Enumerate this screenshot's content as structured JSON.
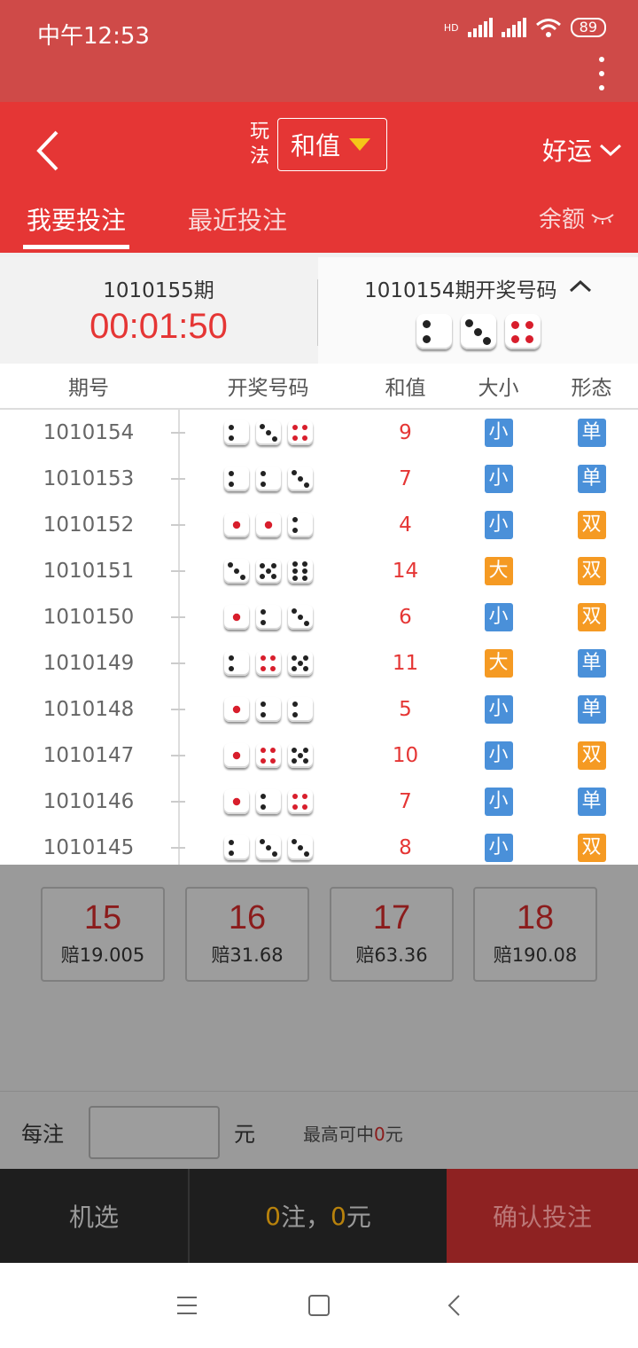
{
  "status": {
    "time": "中午12:53",
    "hd": "HD",
    "battery": "89"
  },
  "header": {
    "play_label": "玩法",
    "play_value": "和值",
    "luck_label": "好运",
    "tabs": {
      "bet": "我要投注",
      "recent": "最近投注"
    },
    "balance_label": "余额"
  },
  "period": {
    "current": "1010155期",
    "countdown": "00:01:50",
    "last_title": "1010154期开奖号码",
    "last_dice": [
      2,
      3,
      4
    ]
  },
  "table": {
    "headers": {
      "issue": "期号",
      "draw": "开奖号码",
      "sum": "和值",
      "size": "大小",
      "form": "形态"
    },
    "rows": [
      {
        "issue": "1010154",
        "dice": [
          2,
          3,
          4
        ],
        "sum": "9",
        "size": "小",
        "form": "单"
      },
      {
        "issue": "1010153",
        "dice": [
          2,
          2,
          3
        ],
        "sum": "7",
        "size": "小",
        "form": "单"
      },
      {
        "issue": "1010152",
        "dice": [
          1,
          1,
          2
        ],
        "sum": "4",
        "size": "小",
        "form": "双"
      },
      {
        "issue": "1010151",
        "dice": [
          3,
          5,
          6
        ],
        "sum": "14",
        "size": "大",
        "form": "双"
      },
      {
        "issue": "1010150",
        "dice": [
          1,
          2,
          3
        ],
        "sum": "6",
        "size": "小",
        "form": "双"
      },
      {
        "issue": "1010149",
        "dice": [
          2,
          4,
          5
        ],
        "sum": "11",
        "size": "大",
        "form": "单"
      },
      {
        "issue": "1010148",
        "dice": [
          1,
          2,
          2
        ],
        "sum": "5",
        "size": "小",
        "form": "单"
      },
      {
        "issue": "1010147",
        "dice": [
          1,
          4,
          5
        ],
        "sum": "10",
        "size": "小",
        "form": "双"
      },
      {
        "issue": "1010146",
        "dice": [
          1,
          2,
          4
        ],
        "sum": "7",
        "size": "小",
        "form": "单"
      },
      {
        "issue": "1010145",
        "dice": [
          2,
          3,
          3
        ],
        "sum": "8",
        "size": "小",
        "form": "双"
      }
    ]
  },
  "odds": [
    {
      "num": "15",
      "rate": "赔19.005"
    },
    {
      "num": "16",
      "rate": "赔31.68"
    },
    {
      "num": "17",
      "rate": "赔63.36"
    },
    {
      "num": "18",
      "rate": "赔190.08"
    }
  ],
  "stake": {
    "label": "每注",
    "unit": "元",
    "max_prefix": "最高可中",
    "max_value": "0",
    "max_suffix": "元"
  },
  "bottom": {
    "random": "机选",
    "count": "0",
    "count_unit": "注，",
    "amount": "0",
    "amount_unit": "元",
    "confirm": "确认投注"
  },
  "colors": {
    "red": "#e53635",
    "badge_blue": "#4a90d9",
    "badge_orange": "#f59a23"
  }
}
